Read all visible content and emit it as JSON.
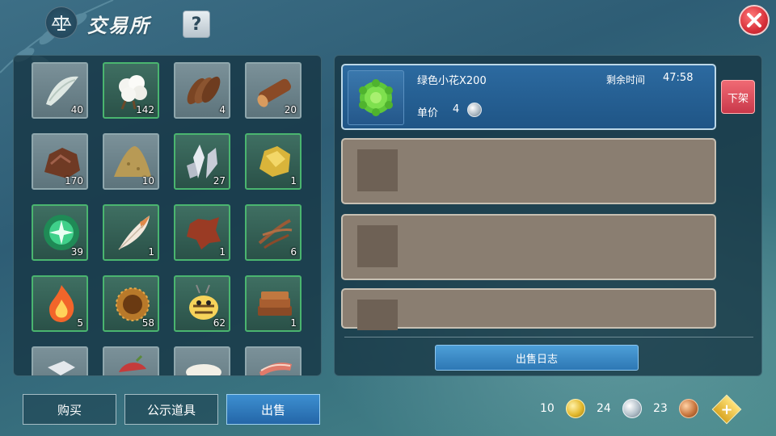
{
  "header": {
    "title": "交易所",
    "help_label": "?",
    "close_icon": "close-icon"
  },
  "inventory": {
    "items": [
      {
        "icon": "cotton-thread-icon",
        "count": "40"
      },
      {
        "icon": "cotton-icon",
        "count": "142"
      },
      {
        "icon": "wood-bundle-icon",
        "count": "4"
      },
      {
        "icon": "log-icon",
        "count": "20"
      },
      {
        "icon": "ore-rock-icon",
        "count": "170"
      },
      {
        "icon": "sand-pile-icon",
        "count": "10"
      },
      {
        "icon": "crystal-icon",
        "count": "27"
      },
      {
        "icon": "gold-ore-icon",
        "count": "1"
      },
      {
        "icon": "green-orb-icon",
        "count": "39"
      },
      {
        "icon": "feather-icon",
        "count": "1"
      },
      {
        "icon": "leather-hide-icon",
        "count": "1"
      },
      {
        "icon": "twigs-icon",
        "count": "6"
      },
      {
        "icon": "flame-icon",
        "count": "5"
      },
      {
        "icon": "nest-icon",
        "count": "58"
      },
      {
        "icon": "bee-icon",
        "count": "62"
      },
      {
        "icon": "leather-stack-icon",
        "count": "1"
      },
      {
        "icon": "stone-block-icon",
        "count": ""
      },
      {
        "icon": "meat-icon",
        "count": ""
      },
      {
        "icon": "plate-icon",
        "count": ""
      },
      {
        "icon": "bacon-icon",
        "count": ""
      }
    ]
  },
  "listings": {
    "active": {
      "name": "绿色小花X200",
      "time_label": "剩余时间",
      "time_value": "47:58",
      "price_label": "单价",
      "price_value": "4",
      "unlist_label": "下架"
    },
    "sales_log_label": "出售日志"
  },
  "tabs": {
    "buy": "购买",
    "public_items": "公示道具",
    "sell": "出售"
  },
  "currency": {
    "gold": "10",
    "silver": "24",
    "copper": "23",
    "add_label": "+"
  }
}
